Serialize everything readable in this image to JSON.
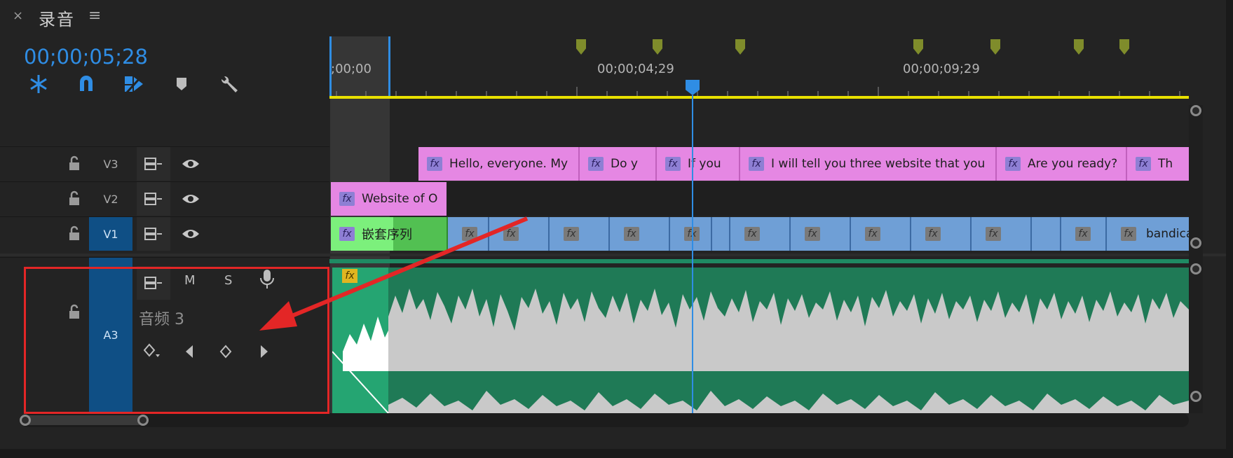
{
  "panel": {
    "title": "录音",
    "close_glyph": "×",
    "menu_glyph": "≡",
    "timecode": "00;00;05;28"
  },
  "toolbar": [
    {
      "name": "snap-insert-icon"
    },
    {
      "name": "magnet-snap-icon"
    },
    {
      "name": "linked-selection-icon"
    },
    {
      "name": "add-marker-icon"
    },
    {
      "name": "wrench-settings-icon"
    }
  ],
  "ruler": {
    "labels": [
      ";00;00",
      "00;00;04;29",
      "00;00;09;29"
    ]
  },
  "tracks": {
    "v3": {
      "id": "V3"
    },
    "v2": {
      "id": "V2"
    },
    "v1": {
      "id": "V1"
    },
    "a3": {
      "id": "A3",
      "name": "音频 3",
      "mute": "M",
      "solo": "S"
    }
  },
  "clips": {
    "v3": [
      {
        "fx": "fx",
        "text": "Hello, everyone. My"
      },
      {
        "fx": "fx",
        "text": "Do y"
      },
      {
        "fx": "fx",
        "text": "If you"
      },
      {
        "fx": "fx",
        "text": "I will tell you three website that you"
      },
      {
        "fx": "fx",
        "text": "Are you ready?"
      },
      {
        "fx": "fx",
        "text": "Th"
      }
    ],
    "v2": [
      {
        "fx": "fx",
        "text": "Website of O"
      }
    ],
    "v1": [
      {
        "fx": "fx",
        "text": "嵌套序列"
      },
      {
        "fx": "fx",
        "text": "bandica"
      }
    ],
    "a3": {
      "fx": "fx"
    }
  },
  "colors": {
    "accent": "#2f8de4",
    "annotation": "#e32626",
    "caption_clip": "#e587e3",
    "video_clip": "#6f9fd6",
    "nested_clip": "#7cf07c",
    "audio_clip": "#1f7a56",
    "work_area": "#e8e000",
    "marker": "#7f8c2b"
  }
}
